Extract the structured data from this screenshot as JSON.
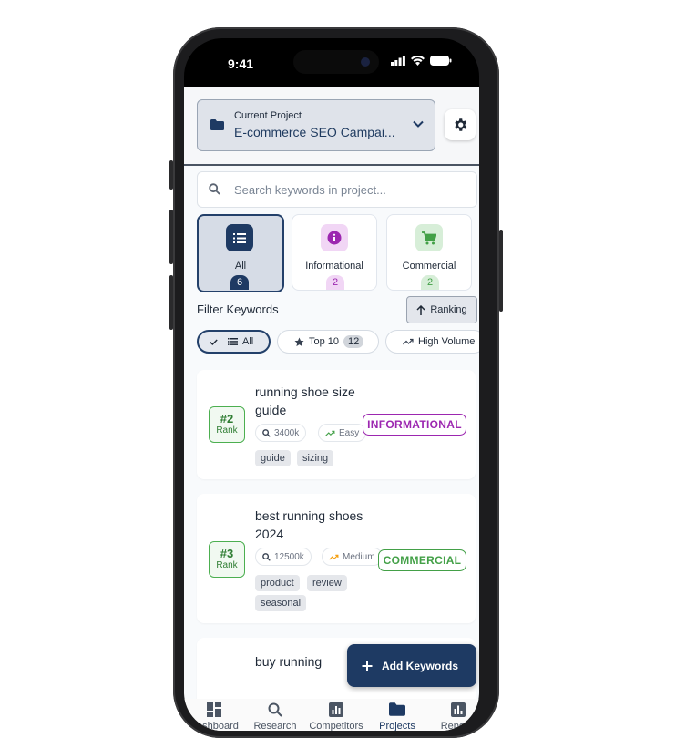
{
  "status_bar": {
    "time": "9:41"
  },
  "header": {
    "project_label": "Current Project",
    "project_value": "E-commerce SEO Campai...",
    "settings_icon": "gear-icon"
  },
  "search": {
    "placeholder": "Search keywords in project..."
  },
  "categories": [
    {
      "name": "All",
      "count": "6",
      "icon": "list-icon",
      "active": true
    },
    {
      "name": "Informational",
      "count": "2",
      "icon": "info-icon"
    },
    {
      "name": "Commercial",
      "count": "2",
      "icon": "cart-icon"
    }
  ],
  "filter": {
    "title": "Filter Keywords",
    "sort_label": "Ranking",
    "chips": [
      {
        "label": "All",
        "active": true
      },
      {
        "label": "Top 10",
        "count": "12"
      },
      {
        "label": "High Volume"
      }
    ]
  },
  "keywords": [
    {
      "rank": "#2",
      "rank_label": "Rank",
      "keyword": "running shoe size guide",
      "volume": "3400k",
      "difficulty": "Easy",
      "intent": "INFORMATIONAL",
      "tags": [
        "guide",
        "sizing"
      ]
    },
    {
      "rank": "#3",
      "rank_label": "Rank",
      "keyword": "best running shoes 2024",
      "volume": "12500k",
      "difficulty": "Medium",
      "intent": "COMMERCIAL",
      "tags": [
        "product",
        "review",
        "seasonal"
      ]
    },
    {
      "keyword": "buy running"
    }
  ],
  "fab": {
    "label": "Add Keywords"
  },
  "nav": [
    {
      "label": "Dashboard",
      "icon": "dashboard-icon"
    },
    {
      "label": "Research",
      "icon": "search-icon"
    },
    {
      "label": "Competitors",
      "icon": "chart-icon"
    },
    {
      "label": "Projects",
      "icon": "folder-icon",
      "active": true
    },
    {
      "label": "Reports",
      "icon": "report-icon"
    }
  ],
  "colors": {
    "primary": "#1e3a63",
    "informational": "#9c27b0",
    "commercial": "#43a047",
    "rank": "#2e7d32"
  }
}
